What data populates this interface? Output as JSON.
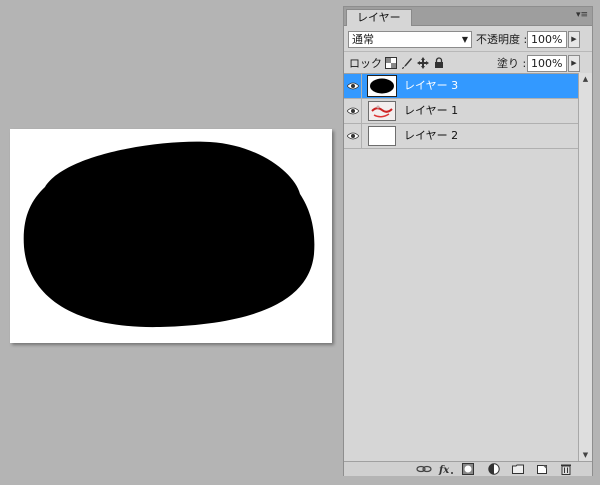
{
  "panel": {
    "tab_label": "レイヤー",
    "menu_icon": "panel-menu-icon"
  },
  "blend": {
    "mode": "通常",
    "opacity_label": "不透明度 :",
    "opacity_value": "100%"
  },
  "lock": {
    "label": "ロック :",
    "icons": [
      "lock-transparent-icon",
      "lock-pixels-icon",
      "lock-position-icon",
      "lock-all-icon"
    ],
    "fill_label": "塗り :",
    "fill_value": "100%"
  },
  "layers": [
    {
      "name": "レイヤー 3",
      "visible": true,
      "selected": true,
      "thumb": "black-ellipse"
    },
    {
      "name": "レイヤー 1",
      "visible": true,
      "selected": false,
      "thumb": "image"
    },
    {
      "name": "レイヤー 2",
      "visible": true,
      "selected": false,
      "thumb": "white"
    }
  ],
  "bottom_icons": [
    "link-layers-icon",
    "fx-icon",
    "add-mask-icon",
    "adjustment-layer-icon",
    "new-group-icon",
    "new-layer-icon",
    "trash-icon"
  ],
  "colors": {
    "selection": "#3399ff",
    "panel_bg": "#d6d6d6",
    "workspace_bg": "#b4b4b4"
  }
}
